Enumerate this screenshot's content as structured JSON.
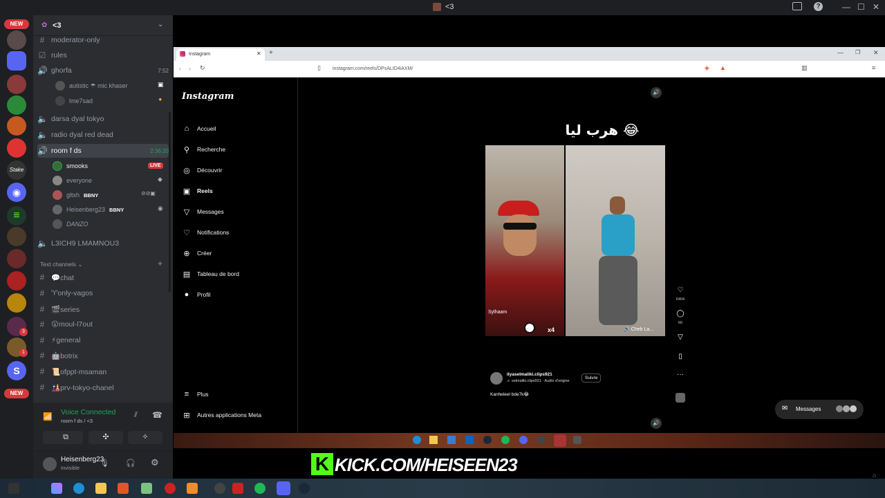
{
  "window": {
    "title": "<3"
  },
  "server": {
    "name": "<3"
  },
  "rail": {
    "new_top": "NEW",
    "new_bottom": "NEW",
    "badges": [
      "3",
      "1"
    ]
  },
  "channels_top": [
    {
      "name": "moderator-only",
      "type": "text"
    },
    {
      "name": "rules",
      "type": "rules"
    },
    {
      "name": "ghorfa",
      "type": "voice",
      "time": "7:52"
    }
  ],
  "ghorfa_users": [
    {
      "name": "autistic ☂ mic khaser"
    },
    {
      "name": "lme7sad"
    }
  ],
  "channels_mid": [
    {
      "name": "darsa dyal tokyo"
    },
    {
      "name": "radio dyal red dead"
    }
  ],
  "room": {
    "name": "room f ds",
    "time": "2:36:20"
  },
  "room_users": [
    {
      "name": "smooks",
      "badge": "LIVE"
    },
    {
      "name": "everyone"
    },
    {
      "name": "gltxh",
      "tag": "BBNY"
    },
    {
      "name": "Heisenberg23",
      "tag": "BBNY"
    },
    {
      "name": "DANZO"
    }
  ],
  "channel_after": "L3ICH9 LMAMNOU3",
  "text_category": "Text channels",
  "text_channels": [
    "💬chat",
    "♈only-vagos",
    "🎬series",
    "😲moul-l7out",
    "⚡general",
    "🤖botrix",
    "📜ofppt-msaman",
    "🎎prv-tokyo-chanel"
  ],
  "voice": {
    "status": "Voice Connected",
    "location": "room f ds / <3"
  },
  "user": {
    "name": "Heisenberg23",
    "status": "Invisible"
  },
  "browser": {
    "tab_title": "Instagram",
    "url": "instagram.com/reels/DPsALID4iAXM/"
  },
  "instagram": {
    "logo": "Instagram",
    "nav": [
      {
        "label": "Accueil",
        "icon": "home-icon",
        "glyph": "⌂"
      },
      {
        "label": "Recherche",
        "icon": "search-icon",
        "glyph": "⚲"
      },
      {
        "label": "Découvrir",
        "icon": "compass-icon",
        "glyph": "◎"
      },
      {
        "label": "Reels",
        "icon": "reels-icon",
        "glyph": "▣"
      },
      {
        "label": "Messages",
        "icon": "send-icon",
        "glyph": "▽"
      },
      {
        "label": "Notifications",
        "icon": "heart-icon",
        "glyph": "♡"
      },
      {
        "label": "Créer",
        "icon": "plus-icon",
        "glyph": "⊕"
      },
      {
        "label": "Tableau de bord",
        "icon": "dashboard-icon",
        "glyph": "▤"
      },
      {
        "label": "Profil",
        "icon": "avatar-icon",
        "glyph": "●"
      }
    ],
    "more": "Plus",
    "meta": "Autres applications Meta",
    "reel": {
      "caption_overlay": "هرب ليا 😂",
      "author": "ilyaselmaliki.clips921",
      "audio": "♬ selmaliki.clips921 · Audio d'origine",
      "follow": "Suivre",
      "description": "Kanheleel bde7k😂",
      "likes": "6404",
      "comments": "60",
      "overlay_left": "Sylhaam",
      "overlay_x": "x4",
      "overlay_right": "🔊 Cheb La..."
    },
    "messages_button": "Messages"
  },
  "stream_overlay": "KICK.COM/HEISEEN23"
}
